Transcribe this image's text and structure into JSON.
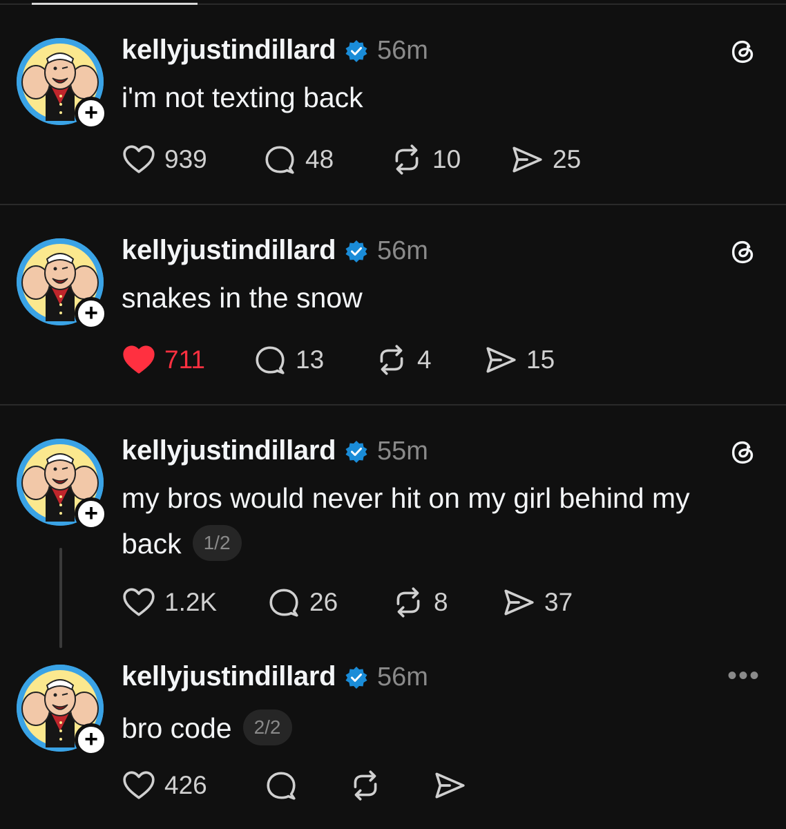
{
  "username": "kellyjustindillard",
  "posts": [
    {
      "time": "56m",
      "text": "i'm not texting back",
      "likes": "939",
      "replies": "48",
      "reposts": "10",
      "shares": "25",
      "liked": false
    },
    {
      "time": "56m",
      "text": "snakes in the snow",
      "likes": "711",
      "replies": "13",
      "reposts": "4",
      "shares": "15",
      "liked": true
    },
    {
      "time": "55m",
      "text_line1": "my bros would never hit on my girl behind my",
      "text_line2": "back",
      "page": "1/2",
      "likes": "1.2K",
      "replies": "26",
      "reposts": "8",
      "shares": "37",
      "liked": false
    },
    {
      "time": "56m",
      "text": "bro code",
      "page": "2/2",
      "likes": "426",
      "liked": false
    }
  ],
  "colors": {
    "liked": "#ff3040",
    "verified": "#1a8cd8",
    "avatar_ring": "#3aa3e6"
  },
  "icons": [
    "heart-icon",
    "reply-icon",
    "repost-icon",
    "share-icon",
    "threads-logo-icon",
    "verified-badge-icon",
    "more-options-icon",
    "follow-plus-icon"
  ]
}
